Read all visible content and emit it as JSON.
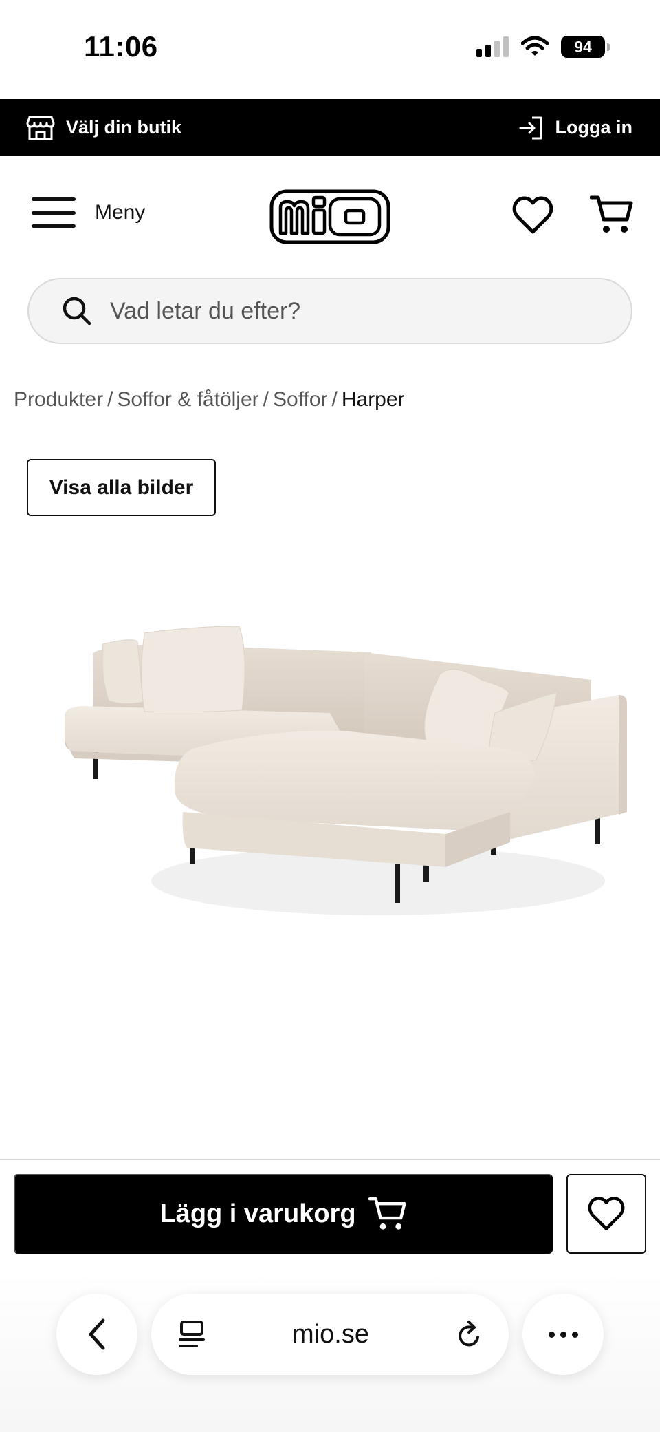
{
  "status_bar": {
    "time": "11:06",
    "battery": "94",
    "signal_bars_active": 2
  },
  "topbar": {
    "store_label": "Välj din butik",
    "login_label": "Logga in"
  },
  "header": {
    "menu_label": "Meny",
    "logo_text": "mio"
  },
  "search": {
    "placeholder": "Vad letar du efter?"
  },
  "breadcrumb": {
    "items": [
      "Produkter",
      "Soffor & fåtöljer",
      "Soffor"
    ],
    "current": "Harper",
    "separator": "/"
  },
  "gallery": {
    "show_all_label": "Visa alla bilder"
  },
  "actions": {
    "add_to_cart_label": "Lägg i varukorg"
  },
  "browser": {
    "url": "mio.se"
  },
  "colors": {
    "primary": "#000000",
    "sofa_fabric": "#ede6dd",
    "search_bg": "#f4f4f4"
  }
}
